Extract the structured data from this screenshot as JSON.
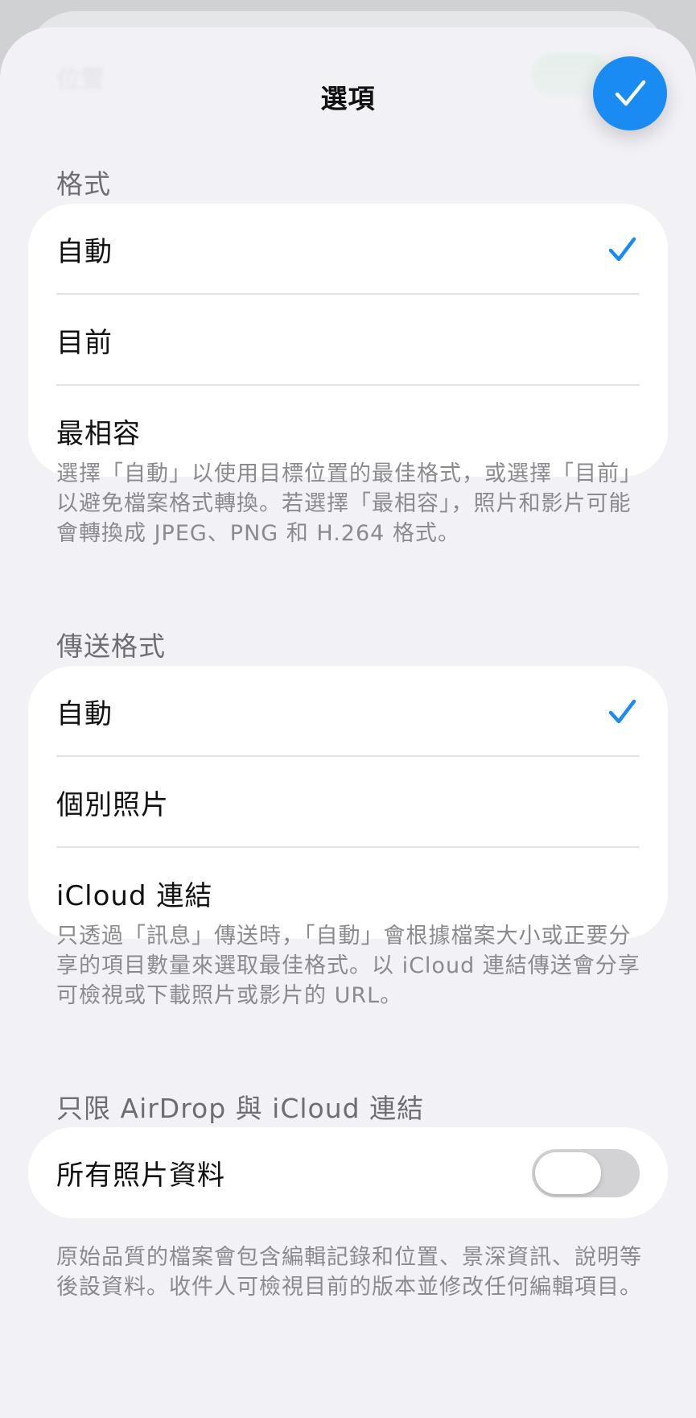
{
  "nav": {
    "title": "選項",
    "background_row_label": "位置"
  },
  "colors": {
    "accent": "#1a8bf3",
    "checkmark": "#1a8bf3",
    "toggle_off": "#d3d3d6"
  },
  "sections": {
    "format": {
      "header": "格式",
      "options": [
        "自動",
        "目前",
        "最相容"
      ],
      "selected": "自動",
      "footnote": "選擇「自動」以使用目標位置的最佳格式，或選擇「目前」以避免檔案格式轉換。若選擇「最相容」，照片和影片可能會轉換成 JPEG、PNG 和 H.264 格式。"
    },
    "send_format": {
      "header": "傳送格式",
      "options": [
        "自動",
        "個別照片",
        "iCloud 連結"
      ],
      "selected": "自動",
      "footnote": "只透過「訊息」傳送時，「自動」會根據檔案大小或正要分享的項目數量來選取最佳格式。以 iCloud 連結傳送會分享可檢視或下載照片或影片的 URL。"
    },
    "airdrop": {
      "header": "只限 AirDrop 與 iCloud 連結",
      "toggle_label": "所有照片資料",
      "toggle_on": false,
      "footnote": "原始品質的檔案會包含編輯記錄和位置、景深資訊、說明等後設資料。收件人可檢視目前的版本並修改任何編輯項目。"
    }
  },
  "icons": {
    "done": "checkmark-icon",
    "selected": "checkmark-icon"
  }
}
